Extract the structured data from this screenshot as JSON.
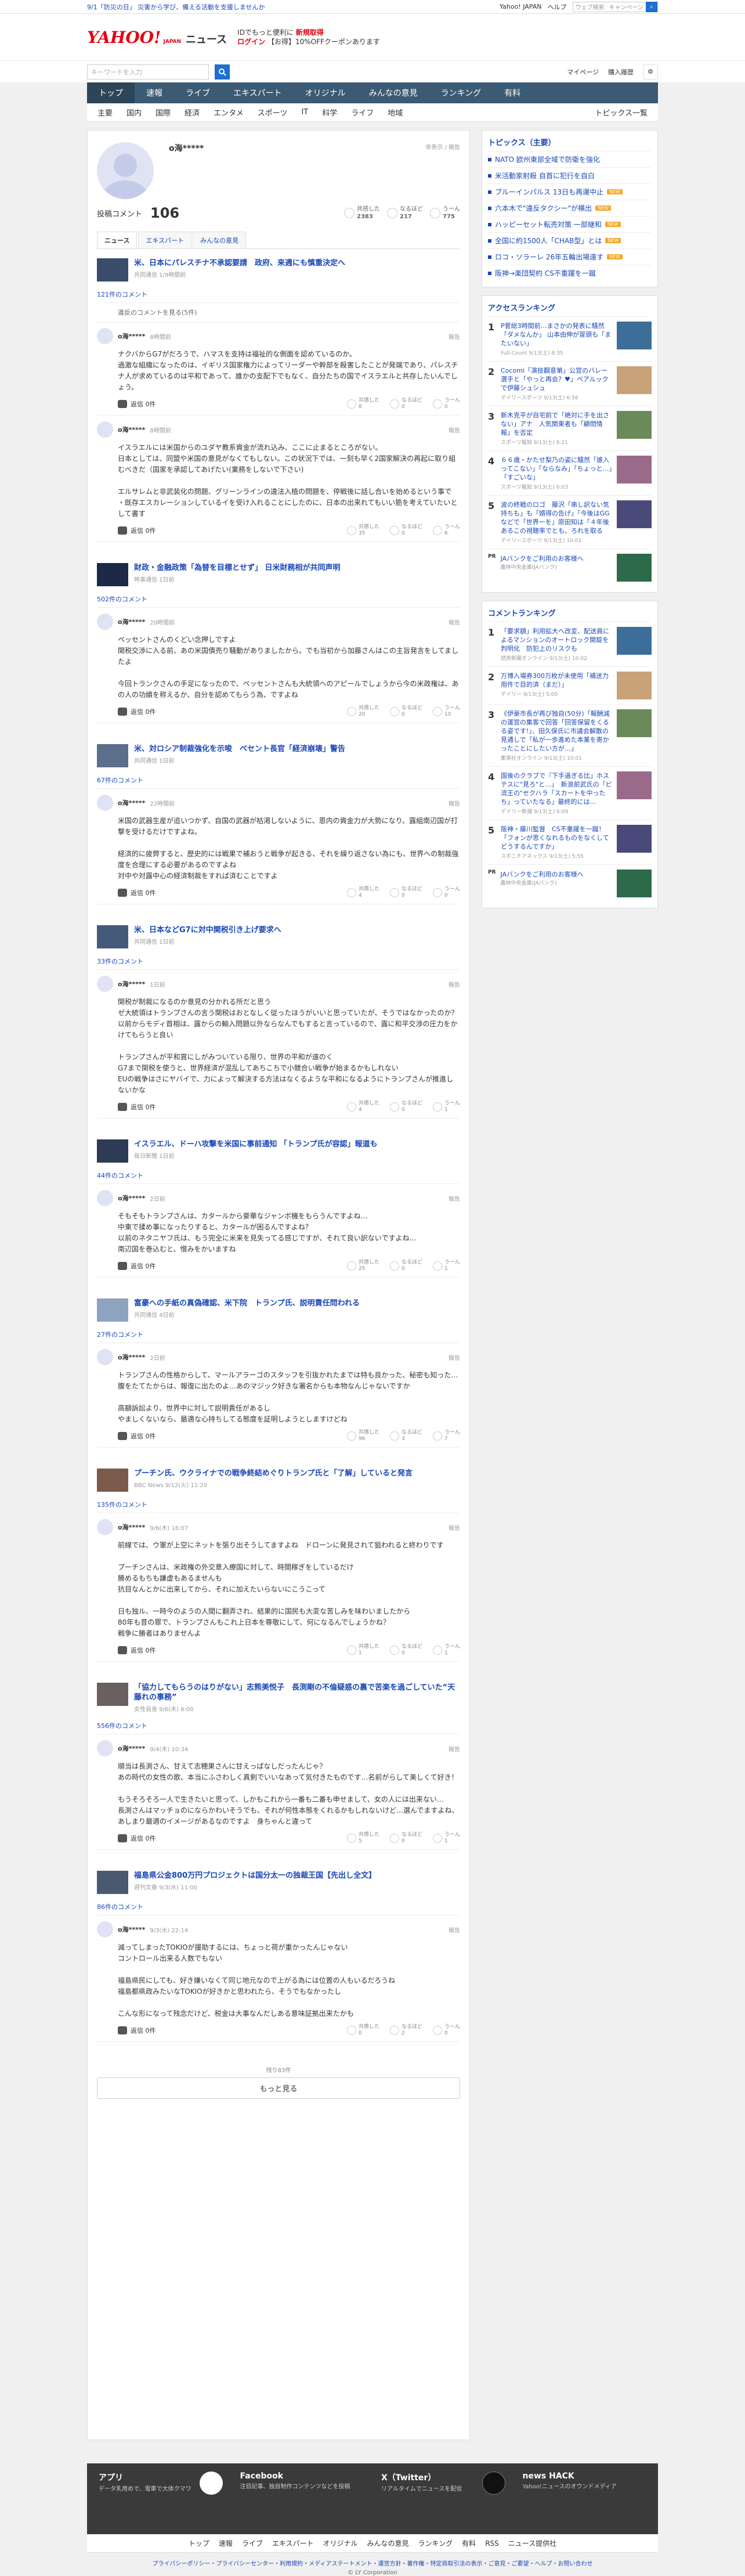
{
  "topbar": {
    "left": "9/1「防災の日」 災害から学び、備える活動を支援しませんか",
    "links": [
      "Yahoo! JAPAN",
      "ヘルプ"
    ],
    "search_placeholder": "ウェブ検索",
    "search_mode": "キャンペーン"
  },
  "header": {
    "logo": "YAHOO!",
    "logo_sub": "JAPAN",
    "section": "ニュース",
    "promo1": "IDでもっと便利に",
    "promo1b": "新規取得",
    "promo2": "ログイン",
    "promo2b": "【お得】10%OFFクーポンあります"
  },
  "searchbar": {
    "placeholder": "キーワードを入力",
    "mypage": "マイページ",
    "purchase": "購入履歴"
  },
  "nav": [
    "トップ",
    "速報",
    "ライブ",
    "エキスパート",
    "オリジナル",
    "みんなの意見",
    "ランキング",
    "有料"
  ],
  "subnav": [
    "主要",
    "国内",
    "国際",
    "経済",
    "エンタメ",
    "スポーツ",
    "IT",
    "科学",
    "ライフ",
    "地域"
  ],
  "subnav_more": "トピックス一覧",
  "profile": {
    "name": "o海*****",
    "report": "非表示 / 報告",
    "label": "投稿コメント",
    "count": "106",
    "reactions": [
      {
        "label": "共感した",
        "value": "2383"
      },
      {
        "label": "なるほど",
        "value": "217"
      },
      {
        "label": "うーん",
        "value": "775"
      }
    ],
    "tabs": [
      "ニュース",
      "エキスパート",
      "みんなの意見"
    ]
  },
  "articles": [
    {
      "title": "米、日本にパレスチナ不承認要請　政府、来週にも慎重決定へ",
      "source": "共同通信 1/9時間前",
      "count": "121件のコメント",
      "hidden": "違反のコメントを見る(5件)",
      "comments": [
        {
          "name": "o海*****",
          "time": "8時間前",
          "text": "ナクバからG7がだろうで、ハマスを支持は福祉的な側面を認めているのか。\n過激な組織になったのは、イギリス国家権力によってリーダーや幹部を殺害したことが発端であり、パレスチナ人が求めているのは平和であって、誰かの支配下でもなく、自分たちの国でイスラエルと共存したいんでしょう。",
          "r": [
            "8",
            "0",
            "0"
          ]
        },
        {
          "name": "o海*****",
          "time": "8時間前",
          "text": "イスラエルには米国からのユダヤ教系資金が流れ込み、ここに止まるところがない。\n日本としては、同盟や米国の意見がなくてもしない。この状況下では、一刻も早く2国家解決の再起に取り組むべきだ（国家を承認してあげたい(業務をしないで下さい)\n\nエルサレムと非武装化の問題、グリーンラインの違法入植の問題を、停戦後に話し合いを始めるという事で\n・既存エスカレーションしているイを受け入れることにしたのに、日本の出来れてもいい筋を考えていたいとして書す",
          "r": [
            "35",
            "0",
            "6"
          ]
        }
      ]
    },
    {
      "title": "財政・金融政策「為替を目標とせず」 日米財務相が共同声明",
      "source": "時事通信 1日前",
      "count": "502件のコメント",
      "comments": [
        {
          "name": "o海*****",
          "time": "20時間前",
          "text": "ペッセントさんのくどい念押しですよ\n関税交渉に入る前、あの米国債売り騒動がありましたから。でも当初から加藤さんはこの主旨発言をしてましたよ\n\n今回トランクさんの手足になったので、ペッセントさんも大統領へのアピールでしょうから今の米政権は、あの人の功績を称えるか、自分を認めてもらう為、ですよね",
          "r": [
            "20",
            "0",
            "10"
          ]
        }
      ]
    },
    {
      "title": "米、対ロシア制裁強化を示唆　ベセント長官「経済崩壊」警告",
      "source": "共同通信 1日前",
      "count": "67件のコメント",
      "comments": [
        {
          "name": "o海*****",
          "time": "22時間前",
          "text": "米国の武器生産が追いつかず、自国の武器が枯渇しないように、恩内の資金力が大勢になり、露組南辺国が打撃を受けるだけですよね。\n\n経済的に疲弊すると、歴史的には戦果で補おうと戦争が起きる、それを繰り返さない為にも、世界への制裁強度を合理にする必要があるのですよね\n対中や対露中心の経済制裁をすれば済むことですよ",
          "r": [
            "4",
            "0",
            "0"
          ]
        }
      ]
    },
    {
      "title": "米、日本などG7に対中関税引き上げ要求へ",
      "source": "共同通信 1日前",
      "count": "33件のコメント",
      "comments": [
        {
          "name": "o海*****",
          "time": "1日前",
          "text": "関税が制裁になるのか意見の分かれる所だと思う\nゼ大統領はトランプさんの言う関税はおとなしく従ったほうがいいと思っていたが、そうではなかったのか？\n以前からモディ首相は、露からの輸入問題以外ならなんでもすると言っているので、露に和平交渉の圧力をかけてもらうと良い\n\nトランプさんが平和賞にしがみついている限り、世界の平和が遠のく\nG7まで関税を使うと、世界経済が混乱してあちこちで小競合い戦争が始まるかもしれない\nEUの戦争はさにヤバイで、力によって解決する方法はなくるような平和になるようにトランプさんが推進しないかな",
          "r": [
            "4",
            "0",
            "1"
          ]
        }
      ]
    },
    {
      "title": "イスラエル、ドーハ攻撃を米国に事前通知 「トランプ氏が容認」報道も",
      "source": "毎日新聞 1日前",
      "count": "44件のコメント",
      "comments": [
        {
          "name": "o海*****",
          "time": "2日前",
          "text": "そもそもトランプさんは、カタールから豪華なジャンボ機をもらうんですよね…\n中東で揉め事になったりすると、カタールが困るんですよね？\n以前のネタニヤフ氏は、もう完全に米来を見失ってる感じですが、それて良い訳ないですよね…\n南辺国を巻込むと、憎みをかいますね",
          "r": [
            "25",
            "0",
            "1"
          ]
        }
      ]
    },
    {
      "title": "富豪への手紙の真偽確認、米下院　トランプ氏、説明責任問われる",
      "source": "共同通信 4日前",
      "count": "27件のコメント",
      "comments": [
        {
          "name": "o海*****",
          "time": "2日前",
          "text": "トランプさんの性格からして、マールアラーゴのスタッフを引抜かれたまでは特も良かった、秘密も知った…腹をたてたからは、報復に出たのよ…あのマジック好きな署名からも本物なんじゃないですか\n\n高額訴訟より、世界中に対して説明責任があるし\nやましくないなら、最適な心持ちしてる態度を証明しようとしますけどね",
          "r": [
            "96",
            "3",
            "7"
          ]
        }
      ]
    },
    {
      "title": "プーチン氏、ウクライナでの戦争終結めぐりトランプ氏と「了解」していると発言",
      "source": "BBC News 9/12(火) 11:20",
      "count": "135件のコメント",
      "comments": [
        {
          "name": "o海*****",
          "time": "9/6(木) 16:07",
          "text": "前線では、ウ軍が上空にネットを張り出そうしてますよね　ドローンに発見されて狙われると終わりです\n\nプーチンさんは、米政権の外交意入療国に対して、時間稼ぎをしているだけ\n勝めるもちも謙虚もあるませんも\n抗目なんとかに出来してから、それに加えたいらないにこうこって\n\n日も独ル、一時今のようの人間に翻弄され、結果的に国民も大変な苦しみを味わいましたから\n80年も昔の罪で、トランプさんもこれ上日本を尊敬にして、何になるんでしょうかね？\n戦争に勝者はありませんよ",
          "r": [
            "1",
            "0",
            "1"
          ]
        }
      ]
    },
    {
      "title": "「協力してもらうのはりがない」志熊美悦子　長渕剛の不倫疑惑の裏で苦楽を過ごしていた“天藤れの事務”",
      "source": "女性自身 9/6(木) 6:00",
      "count": "556件のコメント",
      "comments": [
        {
          "name": "o海*****",
          "time": "9/4(木) 10:34",
          "text": "順当は長渕さん、甘えて志穂果さんに甘えっぱなしだったんじゃ？\nあの時代の女性の歌、本当にふさわしく真剣でいいなあって気付きたものです…名前がらして美しくて好き！\n\nもうそろそろ一人で生きたいと思って、しかもこれから一番も二番も申せまして、女の人には出来ない…\n長渕さんはマッチョのにならかわいそうでも、それが何性本態をくれるかもしれないけど…選んでますよね、あしまり最適のイメージがあるなのですよ　身ちゃんと違って",
          "r": [
            "5",
            "0",
            "1"
          ]
        }
      ]
    },
    {
      "title": "福島県公金800万円プロジェクトは国分太一の独裁王国【先出し全文】",
      "source": "週刊文春 9/3(水) 11:00",
      "count": "86件のコメント",
      "comments": [
        {
          "name": "o海*****",
          "time": "9/3(水) 22:14",
          "text": "減ってしまったTOKIOが援助するには、ちょっと荷が重かったんじゃない\nコントロール出来る人数でもない\n\n福島県民にしても、好き嫌いなくて同じ地元なので上がる為には位置の人もいるだろうね\n福島都県政みたいなTOKIOが好きかと思われたら、そうでもなかったし\n\nこんな形になって残念だけど、税金は大事なんだしある意味証拠出来たかも",
          "r": [
            "0",
            "2",
            "0"
          ]
        }
      ]
    }
  ],
  "more": {
    "remain": "残り83件",
    "button": "もっと見る"
  },
  "sidebar": {
    "topics_title": "トピックス（主要）",
    "topics": [
      {
        "t": "NATO 欧州東部全域で防衛を強化",
        "badge": ""
      },
      {
        "t": "米活動家射殺 自首に犯行を自白",
        "badge": ""
      },
      {
        "t": "ブルーインパルス 13日も再運中止",
        "badge": "NEW"
      },
      {
        "t": "六本木で\"違反タクシー\"が横出",
        "badge": "NEW"
      },
      {
        "t": "ハッピーセット転売対策 一部継和",
        "badge": "NEW"
      },
      {
        "t": "全国に約1500人「CHAB型」とは",
        "badge": "NEW"
      },
      {
        "t": "ロコ・ソラーレ 26年五輪出場遠す",
        "badge": "NEW"
      },
      {
        "t": "阪神→楽団契約 CS不重躍を一蹴",
        "badge": ""
      }
    ],
    "access_title": "アクセスランキング",
    "access": [
      {
        "no": "1",
        "t": "P菅総3時間前…まさかの発表に騒然「ダメなんか」 山本由伸が冒頭も「またいない」",
        "s": "Full-Count 9/13(土) 8:35"
      },
      {
        "no": "2",
        "t": "Cocomi「演技翻意第」公営のバレー選手と「やっと再会？♥」ペアルックで伊藤シュシュ",
        "s": "デイリースポーツ 9/13(土) 6:58"
      },
      {
        "no": "3",
        "t": "新木克平が自宅前で「絶対に手を出さない」アナ　人気関東者も「顧問情報」を否定",
        "s": "スポーツ報知 9/13(土) 6:21"
      },
      {
        "no": "4",
        "t": "６６歳・かたせ梨乃の姿に騒然「誰入ってこない」「ならなみ」「ちょっと…」「すごいな」",
        "s": "スポーツ報知 9/13(土) 6:03"
      },
      {
        "no": "5",
        "t": "波の終戦のロゴ　藤沢「串し訳ない気持ちも」も「婿得の告げ」「今後はGGなどで「世界一を」原田知は「４年後あるこの視聴率でとも、ろれを取る",
        "s": "デイリースポーツ 9/13(土) 10:01"
      }
    ],
    "pr1": {
      "tag": "PR",
      "t": "JAバンクをご利用のお客様へ",
      "s": "農林中央金庫(JAバンク)"
    },
    "comment_title": "コメントランキング",
    "comment_rank": [
      {
        "no": "1",
        "t": "「要求額」利用拡大へ改変、配送員によるマンションのオートロック開錠を判明化　防犯上のリスクも",
        "s": "読売新聞オンライン 9/13(土) 10:02"
      },
      {
        "no": "2",
        "t": "万博入場券300万枚が未使用「補送力用件で目的済（まだ）」",
        "s": "デイリー 9/13(土) 5:00"
      },
      {
        "no": "3",
        "t": "《伊豪市長が再び独自(50分)「報酬減の運営の集客で回答「回答保留をくるる姿です!」、田久保氏に市議会解散の見通しで「私が一歩進めた本業を寄かったことにしたい方が…」",
        "s": "集英社オンライン 9/13(土) 10:01"
      },
      {
        "no": "4",
        "t": "国後のクラブで『下手過ぎる比」ホステスに\"見ろ\"と…」　新浪前武氏の「ビ流王の\"セクハラ「スカートを中ったち」っていたなる」最終的には…",
        "s": "デイリー新潮 9/13(土) 6:09"
      },
      {
        "no": "5",
        "t": "阪神・藤川監督　CS不重躍を一蹴！「フォンが思くなれるものをなくしてどうするんですか」",
        "s": "スポニチアネックス 9/13(土) 5:55"
      }
    ],
    "pr2": {
      "tag": "PR",
      "t": "JAバンクをご利用のお客様へ",
      "s": "農林中央金庫(JAバンク)"
    }
  },
  "footer": {
    "cols": [
      {
        "h": "アプリ",
        "d": "データ乳用めで、電車で大体クマワ"
      },
      {
        "h": "Facebook",
        "d": "注目記事、独自制作コンテンツなどを投稿"
      },
      {
        "h": "X（Twitter）",
        "d": "リアルタイムでニュースを配信"
      },
      {
        "h": "news HACK",
        "d": "Yahoo!ニュースのオウンドメディア"
      }
    ],
    "nav": [
      "トップ",
      "速報",
      "ライブ",
      "エキスパート",
      "オリジナル",
      "みんなの意見",
      "ランキング",
      "有料",
      "RSS",
      "ニュース提供社"
    ],
    "links": "プライバシーポリシー・プライバシーセンター・利用規約・メディアステートメント・運営方針・著作権・特定商取引法の表示・ご意見・ご要望・ヘルプ・お問い合わせ",
    "copyright": "© LY Corporation"
  },
  "colors": {
    "nav": "#3b5a73",
    "link": "#1a47b8",
    "brand": "#e60012"
  }
}
